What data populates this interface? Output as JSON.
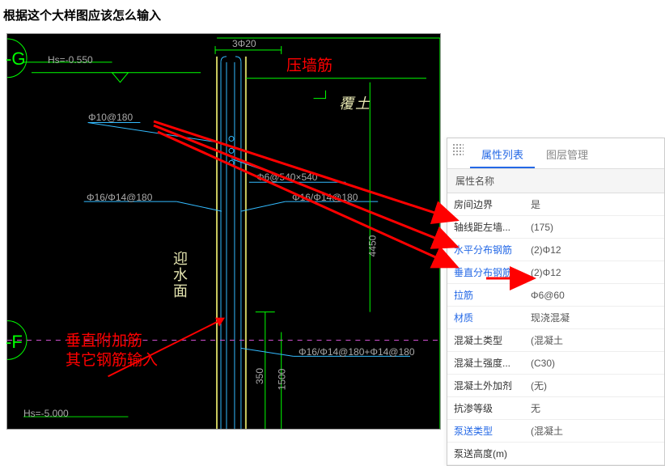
{
  "title": "根据这个大样图应该怎么输入",
  "cad": {
    "top_dim": "3Φ20",
    "hs_top": "Hs=-0.550",
    "hs_bot": "Hs=-5.000",
    "label_10_180": "Φ10@180",
    "label_6_540": "Φ6@540×540",
    "label_16_14_180_left": "Φ16/Φ14@180",
    "label_16_14_180_right": "Φ16/Φ14@180",
    "label_16_14_14_180": "Φ16/Φ14@180+Φ14@180",
    "dim_4450": "4450",
    "dim_1500": "1500",
    "dim_350": "350",
    "yingshui": "迎水面",
    "futu": "覆土",
    "grid_g": "-G",
    "grid_f": "-F"
  },
  "annotations": {
    "yaqiangjin": "压墙筋",
    "chuizhi1": "垂直附加筋",
    "chuizhi2": "其它钢筋输入"
  },
  "panel": {
    "tab_active": "属性列表",
    "tab_other": "图层管理",
    "header": "属性名称",
    "rows": [
      {
        "key": "房间边界",
        "val": "是",
        "link": false
      },
      {
        "key": "轴线距左墙...",
        "val": "(175)",
        "link": false
      },
      {
        "key": "水平分布钢筋",
        "val": "(2)Φ12",
        "link": true
      },
      {
        "key": "垂直分布钢筋",
        "val": "(2)Φ12",
        "link": true
      },
      {
        "key": "拉筋",
        "val": "Φ6@60",
        "link": true
      },
      {
        "key": "材质",
        "val": "现浇混凝",
        "link": true
      },
      {
        "key": "混凝土类型",
        "val": "(混凝土",
        "link": false
      },
      {
        "key": "混凝土强度...",
        "val": "(C30)",
        "link": false
      },
      {
        "key": "混凝土外加剂",
        "val": "(无)",
        "link": false
      },
      {
        "key": "抗渗等级",
        "val": "无",
        "link": false
      },
      {
        "key": "泵送类型",
        "val": "(混凝土",
        "link": true
      },
      {
        "key": "泵送高度(m)",
        "val": "",
        "link": false
      }
    ]
  }
}
